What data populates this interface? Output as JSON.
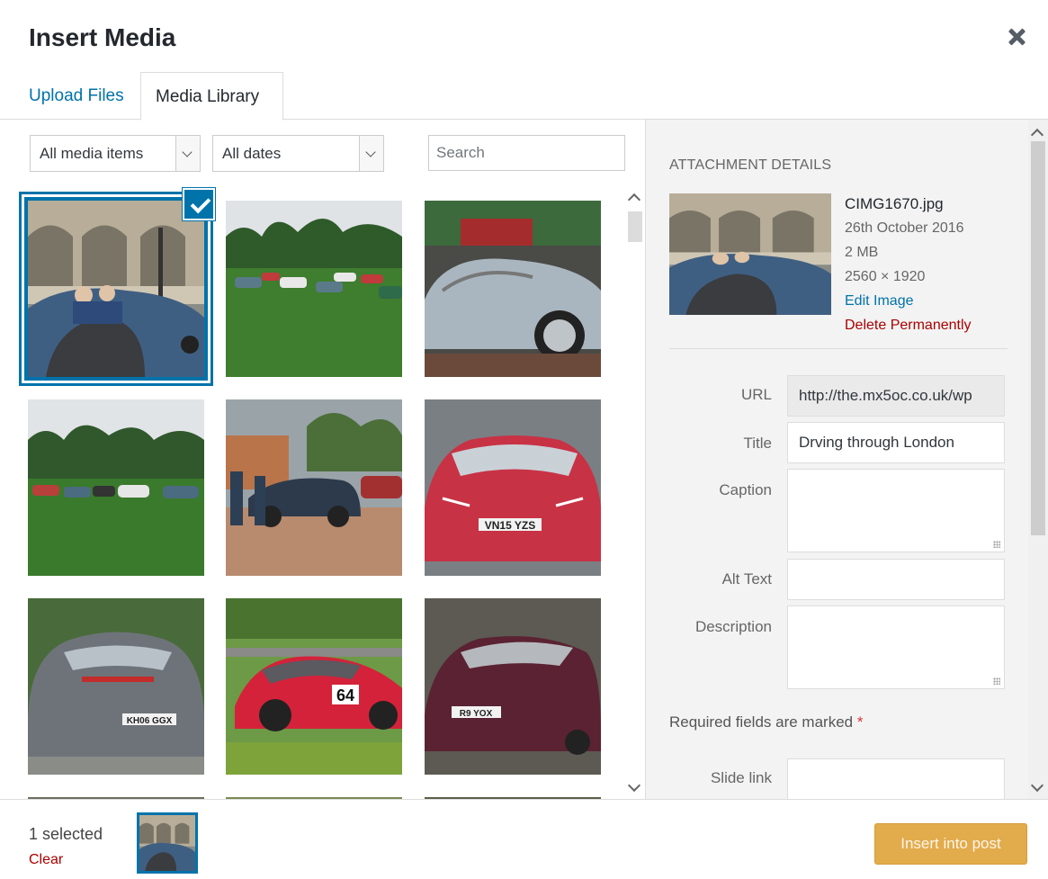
{
  "header": {
    "title": "Insert Media",
    "close_icon": "close-icon"
  },
  "tabs": [
    {
      "label": "Upload Files"
    },
    {
      "label": "Media Library"
    }
  ],
  "filters": {
    "media_type": "All media items",
    "dates": "All dates",
    "search_placeholder": "Search"
  },
  "grid": {
    "items": [
      {
        "desc": "blue convertible by stone building",
        "selected": true
      },
      {
        "desc": "cars parked on grass"
      },
      {
        "desc": "silver convertible"
      },
      {
        "desc": "cars parked on grass field"
      },
      {
        "desc": "dark convertible car park"
      },
      {
        "desc": "red coupe front"
      },
      {
        "desc": "grey race car"
      },
      {
        "desc": "red race car 64"
      },
      {
        "desc": "maroon race car"
      }
    ]
  },
  "details": {
    "heading": "ATTACHMENT DETAILS",
    "filename": "CIMG1670.jpg",
    "date": "26th October 2016",
    "size": "2 MB",
    "dimensions": "2560 × 1920",
    "edit_label": "Edit Image",
    "delete_label": "Delete Permanently",
    "fields": {
      "url_label": "URL",
      "url_value": "http://the.mx5oc.co.uk/wp",
      "title_label": "Title",
      "title_value": "Drving through London",
      "caption_label": "Caption",
      "alt_label": "Alt Text",
      "description_label": "Description",
      "slide_label": "Slide link"
    },
    "required_note": "Required fields are marked",
    "required_star": "*"
  },
  "footer": {
    "selected_count": "1 selected",
    "clear_label": "Clear",
    "insert_label": "Insert into post"
  },
  "colors": {
    "accent": "#0073aa",
    "danger": "#a00",
    "insert_button": "#e2ab4c"
  }
}
